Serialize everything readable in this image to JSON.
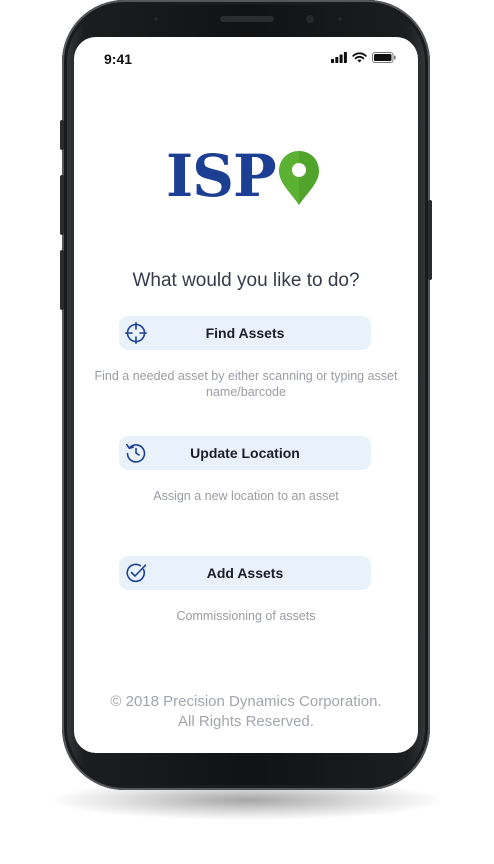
{
  "status_bar": {
    "time": "9:41"
  },
  "logo": {
    "text": "ISP",
    "pin_color": "#5bb132",
    "text_color": "#1c3f94"
  },
  "prompt": "What would you like to do?",
  "actions": [
    {
      "label": "Find Assets",
      "icon": "crosshair-icon",
      "description": "Find a needed asset by either scanning or typing asset name/barcode"
    },
    {
      "label": "Update Location",
      "icon": "refresh-icon",
      "description": "Assign a new location to an asset"
    },
    {
      "label": "Add Assets",
      "icon": "check-circle-icon",
      "description": "Commissioning of assets"
    }
  ],
  "footer": {
    "line1": "© 2018  Precision Dynamics Corporation.",
    "line2": "All Rights Reserved."
  },
  "colors": {
    "button_bg": "#e9f1fb",
    "icon": "#1c3f94",
    "description": "#9a9ca6"
  }
}
